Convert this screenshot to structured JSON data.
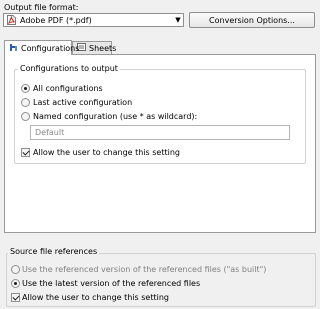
{
  "output_format": {
    "label": "Output file format:",
    "selected": "Adobe PDF (*.pdf)",
    "conversion_button": "Conversion Options..."
  },
  "tabs": [
    {
      "label": "Configurations",
      "icon": "configurations-icon",
      "active": true
    },
    {
      "label": "Sheets",
      "icon": "sheets-icon",
      "active": false
    }
  ],
  "configurations": {
    "group_title": "Configurations to output",
    "options": [
      {
        "label": "All configurations",
        "checked": true
      },
      {
        "label": "Last active configuration",
        "checked": false
      },
      {
        "label": "Named configuration (use * as wildcard):",
        "checked": false
      }
    ],
    "named_placeholder": "Default",
    "allow_change_label": "Allow the user to change this setting",
    "allow_change_checked": true
  },
  "source_refs": {
    "group_title": "Source file references",
    "options": [
      {
        "label": "Use the referenced version of the referenced files (\"as built\")",
        "checked": false,
        "disabled": true
      },
      {
        "label": "Use the latest version of the referenced files",
        "checked": true,
        "disabled": false
      }
    ],
    "allow_change_label": "Allow the user to change this setting",
    "allow_change_checked": true
  },
  "colors": {
    "pdf_red": "#c8281e",
    "tab_icon_blue": "#2a5aa8"
  }
}
